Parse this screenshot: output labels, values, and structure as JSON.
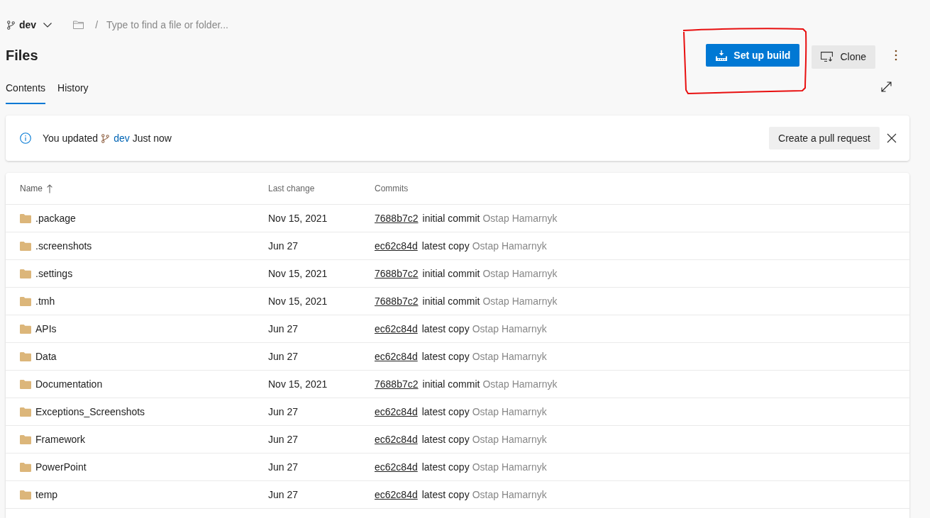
{
  "branch_selector": {
    "branch": "dev"
  },
  "path_search": {
    "separator": "/",
    "placeholder": "Type to find a file or folder..."
  },
  "page_title": "Files",
  "setup_build_button": {
    "label": "Set up build",
    "highlighted": true
  },
  "clone_button": {
    "label": "Clone"
  },
  "tabs": [
    {
      "label": "Contents",
      "selected": true
    },
    {
      "label": "History",
      "selected": false
    }
  ],
  "notification": {
    "message": "You updated",
    "branch": "dev",
    "time": "Just now",
    "action": "Create a pull request"
  },
  "table": {
    "columns": [
      {
        "label": "Name",
        "sorted": true
      },
      {
        "label": "Last change",
        "sorted": false
      },
      {
        "label": "Commits",
        "sorted": false
      }
    ],
    "rows": [
      {
        "kind": "folder",
        "name": ".package",
        "last_change": "Nov 15, 2021",
        "commit_id": "7688b7c2",
        "commit_message": "initial commit",
        "author": "Ostap Hamarnyk"
      },
      {
        "kind": "folder",
        "name": ".screenshots",
        "last_change": "Jun 27",
        "commit_id": "ec62c84d",
        "commit_message": "latest copy",
        "author": "Ostap Hamarnyk"
      },
      {
        "kind": "folder",
        "name": ".settings",
        "last_change": "Nov 15, 2021",
        "commit_id": "7688b7c2",
        "commit_message": "initial commit",
        "author": "Ostap Hamarnyk"
      },
      {
        "kind": "folder",
        "name": ".tmh",
        "last_change": "Nov 15, 2021",
        "commit_id": "7688b7c2",
        "commit_message": "initial commit",
        "author": "Ostap Hamarnyk"
      },
      {
        "kind": "folder",
        "name": "APIs",
        "last_change": "Jun 27",
        "commit_id": "ec62c84d",
        "commit_message": "latest copy",
        "author": "Ostap Hamarnyk"
      },
      {
        "kind": "folder",
        "name": "Data",
        "last_change": "Jun 27",
        "commit_id": "ec62c84d",
        "commit_message": "latest copy",
        "author": "Ostap Hamarnyk"
      },
      {
        "kind": "folder",
        "name": "Documentation",
        "last_change": "Nov 15, 2021",
        "commit_id": "7688b7c2",
        "commit_message": "initial commit",
        "author": "Ostap Hamarnyk"
      },
      {
        "kind": "folder",
        "name": "Exceptions_Screenshots",
        "last_change": "Jun 27",
        "commit_id": "ec62c84d",
        "commit_message": "latest copy",
        "author": "Ostap Hamarnyk"
      },
      {
        "kind": "folder",
        "name": "Framework",
        "last_change": "Jun 27",
        "commit_id": "ec62c84d",
        "commit_message": "latest copy",
        "author": "Ostap Hamarnyk"
      },
      {
        "kind": "folder",
        "name": "PowerPoint",
        "last_change": "Jun 27",
        "commit_id": "ec62c84d",
        "commit_message": "latest copy",
        "author": "Ostap Hamarnyk"
      },
      {
        "kind": "folder",
        "name": "temp",
        "last_change": "Jun 27",
        "commit_id": "ec62c84d",
        "commit_message": "latest copy",
        "author": "Ostap Hamarnyk"
      }
    ]
  }
}
